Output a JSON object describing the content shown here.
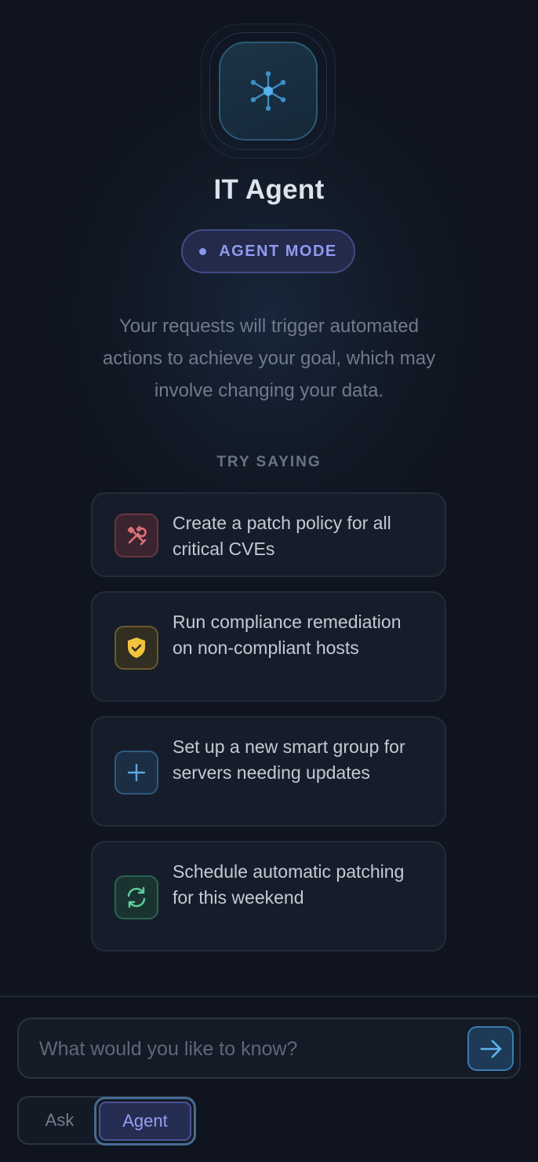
{
  "header": {
    "title": "IT Agent",
    "mode_badge": "AGENT MODE",
    "description": "Your requests will trigger automated actions to achieve your goal, which may involve changing your data."
  },
  "suggestions": {
    "label": "TRY SAYING",
    "items": [
      {
        "text": "Create a patch policy for all critical CVEs",
        "icon": "tools-icon",
        "color": "#e0707a"
      },
      {
        "text": "Run compliance remediation on non-compliant hosts",
        "icon": "shield-check-icon",
        "color": "#f2c33c"
      },
      {
        "text": "Set up a new smart group for servers needing updates",
        "icon": "plus-icon",
        "color": "#5aa8e0"
      },
      {
        "text": "Schedule automatic patching for this weekend",
        "icon": "refresh-icon",
        "color": "#5ccf9c"
      }
    ]
  },
  "composer": {
    "placeholder": "What would you like to know?",
    "send_icon": "arrow-right-icon"
  },
  "mode_toggle": {
    "ask_label": "Ask",
    "agent_label": "Agent",
    "selected": "Agent"
  },
  "colors": {
    "background": "#0f141e",
    "accent": "#8f9af0",
    "card_border": "#232c3a"
  }
}
